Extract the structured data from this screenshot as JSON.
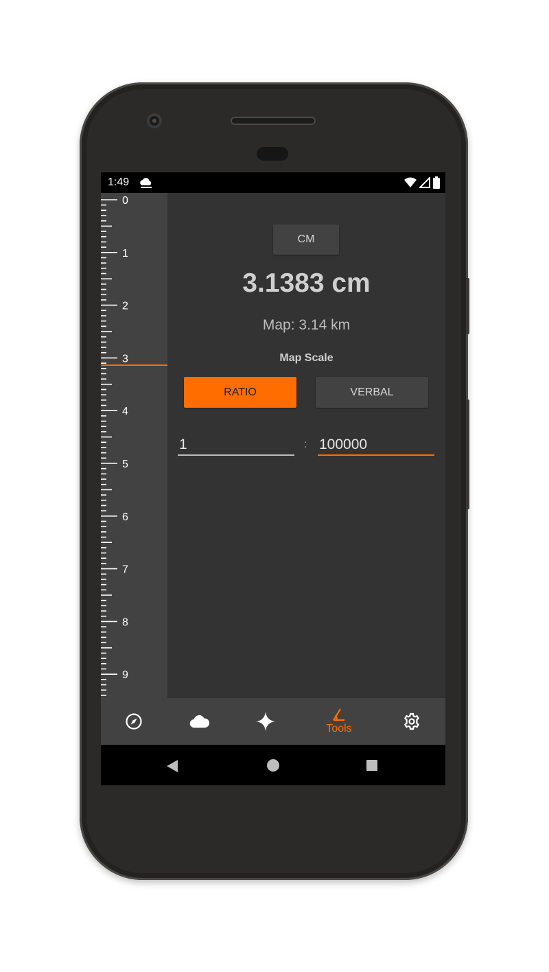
{
  "status": {
    "time": "1:49"
  },
  "ruler": {
    "labels": [
      "0",
      "1",
      "2",
      "3",
      "4",
      "5",
      "6",
      "7",
      "8",
      "9"
    ],
    "marker_value_cm": 3.1383
  },
  "unit_button": {
    "label": "CM"
  },
  "measurement": {
    "value": "3.1383 cm",
    "map_distance": "Map: 3.14 km"
  },
  "map_scale": {
    "title": "Map Scale",
    "ratio_label": "RATIO",
    "verbal_label": "VERBAL",
    "selected": "RATIO",
    "numerator": "1",
    "separator": ":",
    "denominator": "100000"
  },
  "bottom_nav": {
    "items": [
      {
        "icon": "compass-icon",
        "label": ""
      },
      {
        "icon": "cloud-icon",
        "label": ""
      },
      {
        "icon": "astronomy-star-icon",
        "label": ""
      },
      {
        "icon": "ruler-angle-icon",
        "label": "Tools",
        "active": true
      },
      {
        "icon": "gear-icon",
        "label": ""
      }
    ]
  },
  "colors": {
    "accent": "#ff6d00",
    "surface": "#333333",
    "ruler_bg": "#424242",
    "text": "#cfcfcf"
  }
}
